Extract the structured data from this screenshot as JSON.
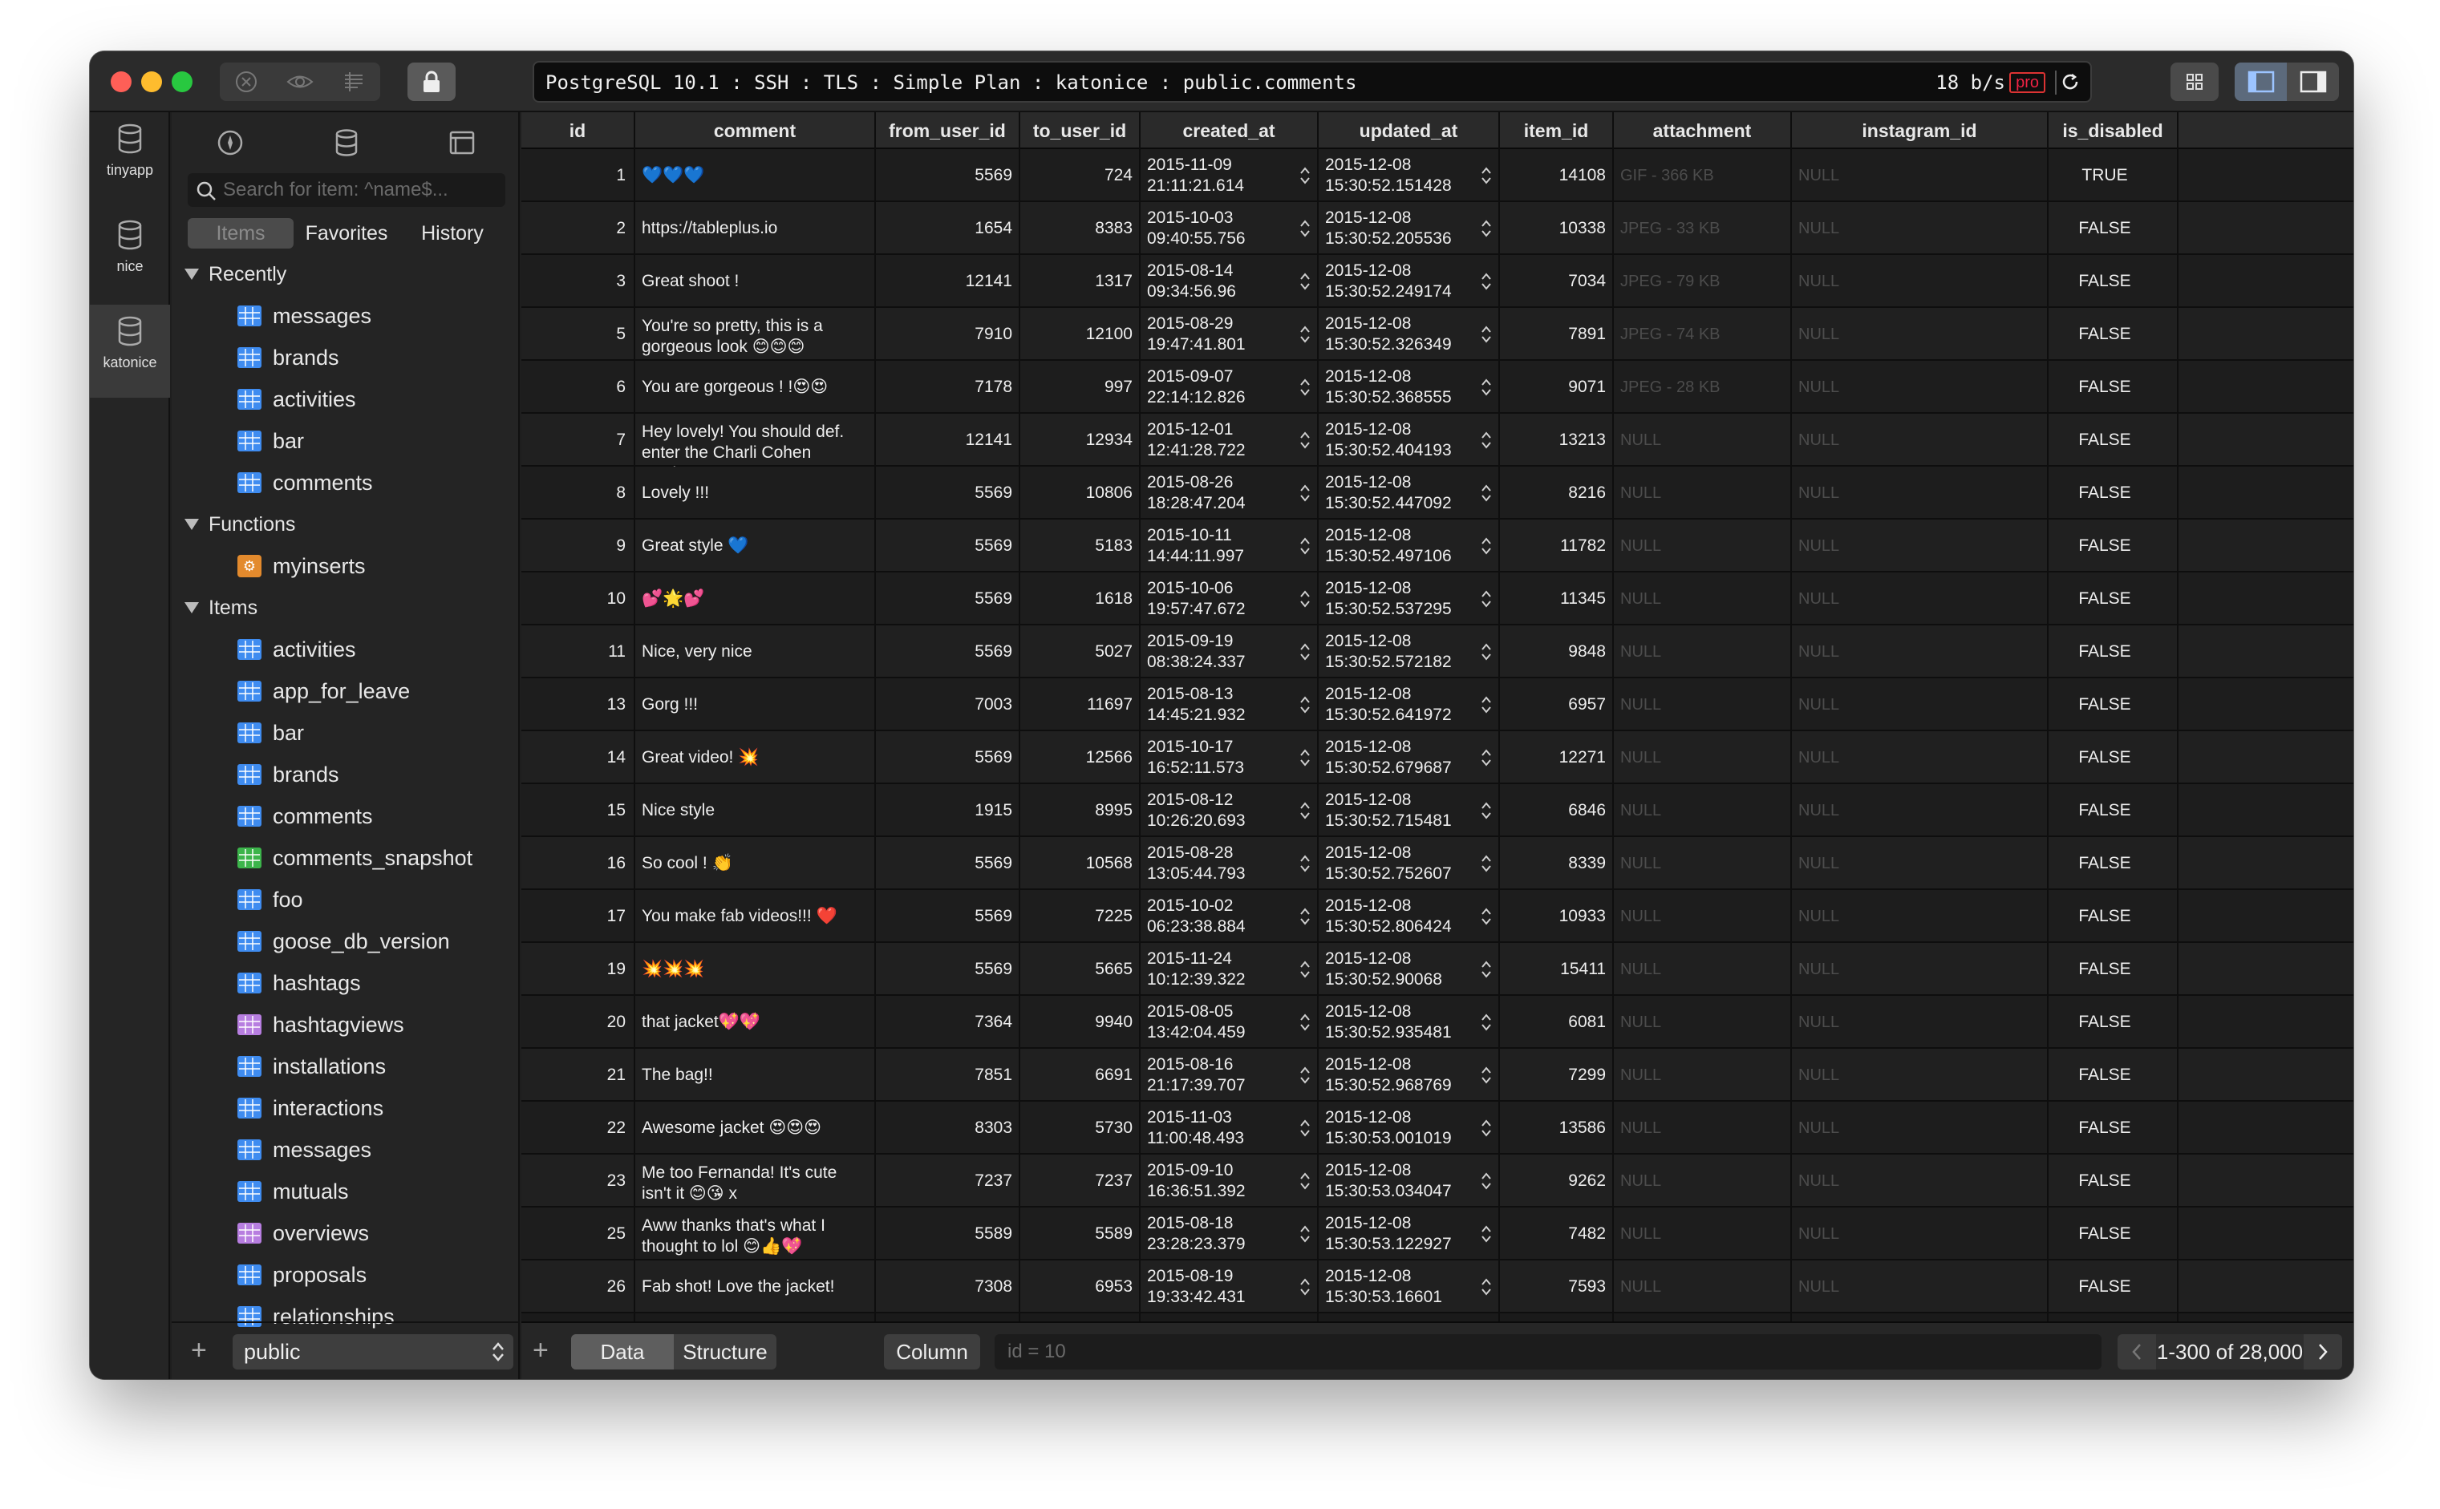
{
  "titlebar": {
    "connection": "PostgreSQL 10.1 : SSH : TLS : Simple Plan : katonice : public.comments",
    "speed": "18 b/s",
    "badge": "pro"
  },
  "connections": [
    {
      "label": "tinyapp"
    },
    {
      "label": "nice"
    },
    {
      "label": "katonice"
    }
  ],
  "sidebar": {
    "search_placeholder": "Search for item: ^name$...",
    "tabs": [
      "Items",
      "Favorites",
      "History"
    ],
    "sections": [
      {
        "title": "Recently",
        "items": [
          {
            "name": "messages",
            "icon": "table-icon",
            "color": "#3f8cf0"
          },
          {
            "name": "brands",
            "icon": "table-icon",
            "color": "#3f8cf0"
          },
          {
            "name": "activities",
            "icon": "table-icon",
            "color": "#3f8cf0"
          },
          {
            "name": "bar",
            "icon": "table-icon",
            "color": "#3f8cf0"
          },
          {
            "name": "comments",
            "icon": "table-icon",
            "color": "#3f8cf0"
          }
        ]
      },
      {
        "title": "Functions",
        "items": [
          {
            "name": "myinserts",
            "icon": "function-icon",
            "color": "#e38a2d"
          }
        ]
      },
      {
        "title": "Items",
        "items": [
          {
            "name": "activities",
            "icon": "table-icon",
            "color": "#3f8cf0"
          },
          {
            "name": "app_for_leave",
            "icon": "table-icon",
            "color": "#3f8cf0"
          },
          {
            "name": "bar",
            "icon": "table-icon",
            "color": "#3f8cf0"
          },
          {
            "name": "brands",
            "icon": "table-icon",
            "color": "#3f8cf0"
          },
          {
            "name": "comments",
            "icon": "table-icon",
            "color": "#3f8cf0"
          },
          {
            "name": "comments_snapshot",
            "icon": "table-icon",
            "color": "#3cb44b"
          },
          {
            "name": "foo",
            "icon": "table-icon",
            "color": "#3f8cf0"
          },
          {
            "name": "goose_db_version",
            "icon": "table-icon",
            "color": "#3f8cf0"
          },
          {
            "name": "hashtags",
            "icon": "table-icon",
            "color": "#3f8cf0"
          },
          {
            "name": "hashtagviews",
            "icon": "table-icon",
            "color": "#b77ee0"
          },
          {
            "name": "installations",
            "icon": "table-icon",
            "color": "#3f8cf0"
          },
          {
            "name": "interactions",
            "icon": "table-icon",
            "color": "#3f8cf0"
          },
          {
            "name": "messages",
            "icon": "table-icon",
            "color": "#3f8cf0"
          },
          {
            "name": "mutuals",
            "icon": "table-icon",
            "color": "#3f8cf0"
          },
          {
            "name": "overviews",
            "icon": "table-icon",
            "color": "#b77ee0"
          },
          {
            "name": "proposals",
            "icon": "table-icon",
            "color": "#3f8cf0"
          },
          {
            "name": "relationships",
            "icon": "table-icon",
            "color": "#3f8cf0"
          }
        ]
      }
    ],
    "schema": "public"
  },
  "grid": {
    "columns": [
      "id",
      "comment",
      "from_user_id",
      "to_user_id",
      "created_at",
      "updated_at",
      "item_id",
      "attachment",
      "instagram_id",
      "is_disabled"
    ],
    "rows": [
      {
        "id": "1",
        "comment": "💙💙💙",
        "from": "5569",
        "to": "724",
        "created": [
          "2015-11-09",
          "21:11:21.614"
        ],
        "updated": [
          "2015-12-08",
          "15:30:52.151428"
        ],
        "item": "14108",
        "attachment": "GIF - 366 KB",
        "instagram": "NULL",
        "disabled": "TRUE"
      },
      {
        "id": "2",
        "comment": "https://tableplus.io",
        "from": "1654",
        "to": "8383",
        "created": [
          "2015-10-03",
          "09:40:55.756"
        ],
        "updated": [
          "2015-12-08",
          "15:30:52.205536"
        ],
        "item": "10338",
        "attachment": "JPEG - 33 KB",
        "instagram": "NULL",
        "disabled": "FALSE"
      },
      {
        "id": "3",
        "comment": "Great shoot !",
        "from": "12141",
        "to": "1317",
        "created": [
          "2015-08-14",
          "09:34:56.96"
        ],
        "updated": [
          "2015-12-08",
          "15:30:52.249174"
        ],
        "item": "7034",
        "attachment": "JPEG - 79 KB",
        "instagram": "NULL",
        "disabled": "FALSE"
      },
      {
        "id": "5",
        "comment": "You're so pretty, this is a gorgeous look 😊😊😊",
        "from": "7910",
        "to": "12100",
        "created": [
          "2015-08-29",
          "19:47:41.801"
        ],
        "updated": [
          "2015-12-08",
          "15:30:52.326349"
        ],
        "item": "7891",
        "attachment": "JPEG - 74 KB",
        "instagram": "NULL",
        "disabled": "FALSE"
      },
      {
        "id": "6",
        "comment": "You are gorgeous ! !😍😍",
        "from": "7178",
        "to": "997",
        "created": [
          "2015-09-07",
          "22:14:12.826"
        ],
        "updated": [
          "2015-12-08",
          "15:30:52.368555"
        ],
        "item": "9071",
        "attachment": "JPEG - 28 KB",
        "instagram": "NULL",
        "disabled": "FALSE"
      },
      {
        "id": "7",
        "comment": "Hey lovely! You should def. enter the Charli Cohen casting...",
        "from": "12141",
        "to": "12934",
        "created": [
          "2015-12-01",
          "12:41:28.722"
        ],
        "updated": [
          "2015-12-08",
          "15:30:52.404193"
        ],
        "item": "13213",
        "attachment": "NULL",
        "instagram": "NULL",
        "disabled": "FALSE"
      },
      {
        "id": "8",
        "comment": "Lovely !!!",
        "from": "5569",
        "to": "10806",
        "created": [
          "2015-08-26",
          "18:28:47.204"
        ],
        "updated": [
          "2015-12-08",
          "15:30:52.447092"
        ],
        "item": "8216",
        "attachment": "NULL",
        "instagram": "NULL",
        "disabled": "FALSE"
      },
      {
        "id": "9",
        "comment": "Great style 💙",
        "from": "5569",
        "to": "5183",
        "created": [
          "2015-10-11",
          "14:44:11.997"
        ],
        "updated": [
          "2015-12-08",
          "15:30:52.497106"
        ],
        "item": "11782",
        "attachment": "NULL",
        "instagram": "NULL",
        "disabled": "FALSE"
      },
      {
        "id": "10",
        "comment": "💕🌟💕",
        "from": "5569",
        "to": "1618",
        "created": [
          "2015-10-06",
          "19:57:47.672"
        ],
        "updated": [
          "2015-12-08",
          "15:30:52.537295"
        ],
        "item": "11345",
        "attachment": "NULL",
        "instagram": "NULL",
        "disabled": "FALSE"
      },
      {
        "id": "11",
        "comment": "Nice, very nice",
        "from": "5569",
        "to": "5027",
        "created": [
          "2015-09-19",
          "08:38:24.337"
        ],
        "updated": [
          "2015-12-08",
          "15:30:52.572182"
        ],
        "item": "9848",
        "attachment": "NULL",
        "instagram": "NULL",
        "disabled": "FALSE"
      },
      {
        "id": "13",
        "comment": "Gorg !!!",
        "from": "7003",
        "to": "11697",
        "created": [
          "2015-08-13",
          "14:45:21.932"
        ],
        "updated": [
          "2015-12-08",
          "15:30:52.641972"
        ],
        "item": "6957",
        "attachment": "NULL",
        "instagram": "NULL",
        "disabled": "FALSE"
      },
      {
        "id": "14",
        "comment": "Great video! 💥",
        "from": "5569",
        "to": "12566",
        "created": [
          "2015-10-17",
          "16:52:11.573"
        ],
        "updated": [
          "2015-12-08",
          "15:30:52.679687"
        ],
        "item": "12271",
        "attachment": "NULL",
        "instagram": "NULL",
        "disabled": "FALSE"
      },
      {
        "id": "15",
        "comment": "Nice style",
        "from": "1915",
        "to": "8995",
        "created": [
          "2015-08-12",
          "10:26:20.693"
        ],
        "updated": [
          "2015-12-08",
          "15:30:52.715481"
        ],
        "item": "6846",
        "attachment": "NULL",
        "instagram": "NULL",
        "disabled": "FALSE"
      },
      {
        "id": "16",
        "comment": "So cool ! 👏",
        "from": "5569",
        "to": "10568",
        "created": [
          "2015-08-28",
          "13:05:44.793"
        ],
        "updated": [
          "2015-12-08",
          "15:30:52.752607"
        ],
        "item": "8339",
        "attachment": "NULL",
        "instagram": "NULL",
        "disabled": "FALSE"
      },
      {
        "id": "17",
        "comment": "You make fab videos!!! ❤️",
        "from": "5569",
        "to": "7225",
        "created": [
          "2015-10-02",
          "06:23:38.884"
        ],
        "updated": [
          "2015-12-08",
          "15:30:52.806424"
        ],
        "item": "10933",
        "attachment": "NULL",
        "instagram": "NULL",
        "disabled": "FALSE"
      },
      {
        "id": "19",
        "comment": "💥💥💥",
        "from": "5569",
        "to": "5665",
        "created": [
          "2015-11-24",
          "10:12:39.322"
        ],
        "updated": [
          "2015-12-08",
          "15:30:52.90068"
        ],
        "item": "15411",
        "attachment": "NULL",
        "instagram": "NULL",
        "disabled": "FALSE"
      },
      {
        "id": "20",
        "comment": " that jacket💖💖",
        "from": "7364",
        "to": "9940",
        "created": [
          "2015-08-05",
          "13:42:04.459"
        ],
        "updated": [
          "2015-12-08",
          "15:30:52.935481"
        ],
        "item": "6081",
        "attachment": "NULL",
        "instagram": "NULL",
        "disabled": "FALSE"
      },
      {
        "id": "21",
        "comment": "The bag!!",
        "from": "7851",
        "to": "6691",
        "created": [
          "2015-08-16",
          "21:17:39.707"
        ],
        "updated": [
          "2015-12-08",
          "15:30:52.968769"
        ],
        "item": "7299",
        "attachment": "NULL",
        "instagram": "NULL",
        "disabled": "FALSE"
      },
      {
        "id": "22",
        "comment": "Awesome jacket 😍😍😍",
        "from": "8303",
        "to": "5730",
        "created": [
          "2015-11-03",
          "11:00:48.493"
        ],
        "updated": [
          "2015-12-08",
          "15:30:53.001019"
        ],
        "item": "13586",
        "attachment": "NULL",
        "instagram": "NULL",
        "disabled": "FALSE"
      },
      {
        "id": "23",
        "comment": "Me too Fernanda! It's cute isn't it 😊😘 x",
        "from": "7237",
        "to": "7237",
        "created": [
          "2015-09-10",
          "16:36:51.392"
        ],
        "updated": [
          "2015-12-08",
          "15:30:53.034047"
        ],
        "item": "9262",
        "attachment": "NULL",
        "instagram": "NULL",
        "disabled": "FALSE"
      },
      {
        "id": "25",
        "comment": "Aww thanks that's what I thought to lol 😊👍💖",
        "from": "5589",
        "to": "5589",
        "created": [
          "2015-08-18",
          "23:28:23.379"
        ],
        "updated": [
          "2015-12-08",
          "15:30:53.122927"
        ],
        "item": "7482",
        "attachment": "NULL",
        "instagram": "NULL",
        "disabled": "FALSE"
      },
      {
        "id": "26",
        "comment": "Fab shot! Love the jacket!",
        "from": "7308",
        "to": "6953",
        "created": [
          "2015-08-19",
          "19:33:42.431"
        ],
        "updated": [
          "2015-12-08",
          "15:30:53.16601"
        ],
        "item": "7593",
        "attachment": "NULL",
        "instagram": "NULL",
        "disabled": "FALSE"
      }
    ]
  },
  "bottombar": {
    "tabs": [
      "Data",
      "Structure"
    ],
    "column_button": "Column",
    "filter_placeholder": "id = 10",
    "pagination": "1-300 of 28,000"
  },
  "colors": {
    "accent": "#3f8cf0",
    "window_bg": "#1e1e1e",
    "pro_badge": "#e22244"
  }
}
